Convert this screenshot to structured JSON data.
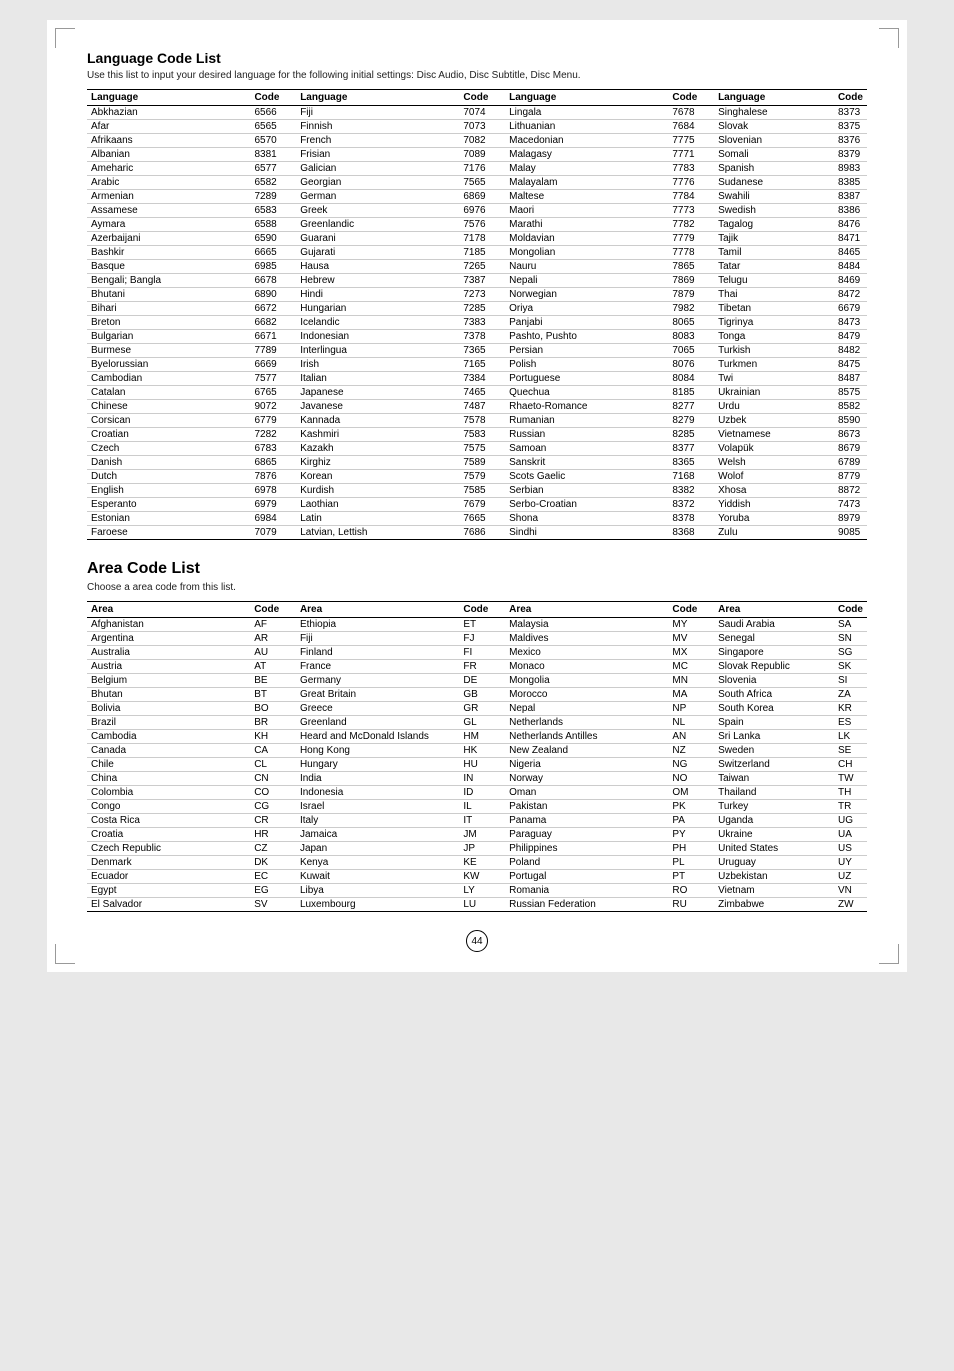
{
  "page": {
    "number": "44",
    "language_section": {
      "title": "Language Code List",
      "subtitle": "Use this list to input your desired language for the following initial settings: Disc Audio, Disc Subtitle, Disc Menu.",
      "columns": [
        "Language",
        "Code",
        "Language",
        "Code",
        "Language",
        "Code",
        "Language",
        "Code"
      ],
      "rows": [
        [
          "Abkhazian",
          "6566",
          "Fiji",
          "7074",
          "Lingala",
          "7678",
          "Singhalese",
          "8373"
        ],
        [
          "Afar",
          "6565",
          "Finnish",
          "7073",
          "Lithuanian",
          "7684",
          "Slovak",
          "8375"
        ],
        [
          "Afrikaans",
          "6570",
          "French",
          "7082",
          "Macedonian",
          "7775",
          "Slovenian",
          "8376"
        ],
        [
          "Albanian",
          "8381",
          "Frisian",
          "7089",
          "Malagasy",
          "7771",
          "Somali",
          "8379"
        ],
        [
          "Ameharic",
          "6577",
          "Galician",
          "7176",
          "Malay",
          "7783",
          "Spanish",
          "8983"
        ],
        [
          "Arabic",
          "6582",
          "Georgian",
          "7565",
          "Malayalam",
          "7776",
          "Sudanese",
          "8385"
        ],
        [
          "Armenian",
          "7289",
          "German",
          "6869",
          "Maltese",
          "7784",
          "Swahili",
          "8387"
        ],
        [
          "Assamese",
          "6583",
          "Greek",
          "6976",
          "Maori",
          "7773",
          "Swedish",
          "8386"
        ],
        [
          "Aymara",
          "6588",
          "Greenlandic",
          "7576",
          "Marathi",
          "7782",
          "Tagalog",
          "8476"
        ],
        [
          "Azerbaijani",
          "6590",
          "Guarani",
          "7178",
          "Moldavian",
          "7779",
          "Tajik",
          "8471"
        ],
        [
          "Bashkir",
          "6665",
          "Gujarati",
          "7185",
          "Mongolian",
          "7778",
          "Tamil",
          "8465"
        ],
        [
          "Basque",
          "6985",
          "Hausa",
          "7265",
          "Nauru",
          "7865",
          "Tatar",
          "8484"
        ],
        [
          "Bengali; Bangla",
          "6678",
          "Hebrew",
          "7387",
          "Nepali",
          "7869",
          "Telugu",
          "8469"
        ],
        [
          "Bhutani",
          "6890",
          "Hindi",
          "7273",
          "Norwegian",
          "7879",
          "Thai",
          "8472"
        ],
        [
          "Bihari",
          "6672",
          "Hungarian",
          "7285",
          "Oriya",
          "7982",
          "Tibetan",
          "6679"
        ],
        [
          "Breton",
          "6682",
          "Icelandic",
          "7383",
          "Panjabi",
          "8065",
          "Tigrinya",
          "8473"
        ],
        [
          "Bulgarian",
          "6671",
          "Indonesian",
          "7378",
          "Pashto, Pushto",
          "8083",
          "Tonga",
          "8479"
        ],
        [
          "Burmese",
          "7789",
          "Interlingua",
          "7365",
          "Persian",
          "7065",
          "Turkish",
          "8482"
        ],
        [
          "Byelorussian",
          "6669",
          "Irish",
          "7165",
          "Polish",
          "8076",
          "Turkmen",
          "8475"
        ],
        [
          "Cambodian",
          "7577",
          "Italian",
          "7384",
          "Portuguese",
          "8084",
          "Twi",
          "8487"
        ],
        [
          "Catalan",
          "6765",
          "Japanese",
          "7465",
          "Quechua",
          "8185",
          "Ukrainian",
          "8575"
        ],
        [
          "Chinese",
          "9072",
          "Javanese",
          "7487",
          "Rhaeto-Romance",
          "8277",
          "Urdu",
          "8582"
        ],
        [
          "Corsican",
          "6779",
          "Kannada",
          "7578",
          "Rumanian",
          "8279",
          "Uzbek",
          "8590"
        ],
        [
          "Croatian",
          "7282",
          "Kashmiri",
          "7583",
          "Russian",
          "8285",
          "Vietnamese",
          "8673"
        ],
        [
          "Czech",
          "6783",
          "Kazakh",
          "7575",
          "Samoan",
          "8377",
          "Volapük",
          "8679"
        ],
        [
          "Danish",
          "6865",
          "Kirghiz",
          "7589",
          "Sanskrit",
          "8365",
          "Welsh",
          "6789"
        ],
        [
          "Dutch",
          "7876",
          "Korean",
          "7579",
          "Scots Gaelic",
          "7168",
          "Wolof",
          "8779"
        ],
        [
          "English",
          "6978",
          "Kurdish",
          "7585",
          "Serbian",
          "8382",
          "Xhosa",
          "8872"
        ],
        [
          "Esperanto",
          "6979",
          "Laothian",
          "7679",
          "Serbo-Croatian",
          "8372",
          "Yiddish",
          "7473"
        ],
        [
          "Estonian",
          "6984",
          "Latin",
          "7665",
          "Shona",
          "8378",
          "Yoruba",
          "8979"
        ],
        [
          "Faroese",
          "7079",
          "Latvian, Lettish",
          "7686",
          "Sindhi",
          "8368",
          "Zulu",
          "9085"
        ]
      ]
    },
    "area_section": {
      "title": "Area Code List",
      "subtitle": "Choose a area code from this list.",
      "columns": [
        "Area",
        "Code",
        "Area",
        "Code",
        "Area",
        "Code",
        "Area",
        "Code"
      ],
      "rows": [
        [
          "Afghanistan",
          "AF",
          "Ethiopia",
          "ET",
          "Malaysia",
          "MY",
          "Saudi Arabia",
          "SA"
        ],
        [
          "Argentina",
          "AR",
          "Fiji",
          "FJ",
          "Maldives",
          "MV",
          "Senegal",
          "SN"
        ],
        [
          "Australia",
          "AU",
          "Finland",
          "FI",
          "Mexico",
          "MX",
          "Singapore",
          "SG"
        ],
        [
          "Austria",
          "AT",
          "France",
          "FR",
          "Monaco",
          "MC",
          "Slovak Republic",
          "SK"
        ],
        [
          "Belgium",
          "BE",
          "Germany",
          "DE",
          "Mongolia",
          "MN",
          "Slovenia",
          "SI"
        ],
        [
          "Bhutan",
          "BT",
          "Great Britain",
          "GB",
          "Morocco",
          "MA",
          "South Africa",
          "ZA"
        ],
        [
          "Bolivia",
          "BO",
          "Greece",
          "GR",
          "Nepal",
          "NP",
          "South Korea",
          "KR"
        ],
        [
          "Brazil",
          "BR",
          "Greenland",
          "GL",
          "Netherlands",
          "NL",
          "Spain",
          "ES"
        ],
        [
          "Cambodia",
          "KH",
          "Heard and McDonald Islands",
          "HM",
          "Netherlands Antilles",
          "AN",
          "Sri Lanka",
          "LK"
        ],
        [
          "Canada",
          "CA",
          "Hong Kong",
          "HK",
          "New Zealand",
          "NZ",
          "Sweden",
          "SE"
        ],
        [
          "Chile",
          "CL",
          "Hungary",
          "HU",
          "Nigeria",
          "NG",
          "Switzerland",
          "CH"
        ],
        [
          "China",
          "CN",
          "India",
          "IN",
          "Norway",
          "NO",
          "Taiwan",
          "TW"
        ],
        [
          "Colombia",
          "CO",
          "Indonesia",
          "ID",
          "Oman",
          "OM",
          "Thailand",
          "TH"
        ],
        [
          "Congo",
          "CG",
          "Israel",
          "IL",
          "Pakistan",
          "PK",
          "Turkey",
          "TR"
        ],
        [
          "Costa Rica",
          "CR",
          "Italy",
          "IT",
          "Panama",
          "PA",
          "Uganda",
          "UG"
        ],
        [
          "Croatia",
          "HR",
          "Jamaica",
          "JM",
          "Paraguay",
          "PY",
          "Ukraine",
          "UA"
        ],
        [
          "Czech Republic",
          "CZ",
          "Japan",
          "JP",
          "Philippines",
          "PH",
          "United States",
          "US"
        ],
        [
          "Denmark",
          "DK",
          "Kenya",
          "KE",
          "Poland",
          "PL",
          "Uruguay",
          "UY"
        ],
        [
          "Ecuador",
          "EC",
          "Kuwait",
          "KW",
          "Portugal",
          "PT",
          "Uzbekistan",
          "UZ"
        ],
        [
          "Egypt",
          "EG",
          "Libya",
          "LY",
          "Romania",
          "RO",
          "Vietnam",
          "VN"
        ],
        [
          "El Salvador",
          "SV",
          "Luxembourg",
          "LU",
          "Russian Federation",
          "RU",
          "Zimbabwe",
          "ZW"
        ]
      ]
    }
  }
}
